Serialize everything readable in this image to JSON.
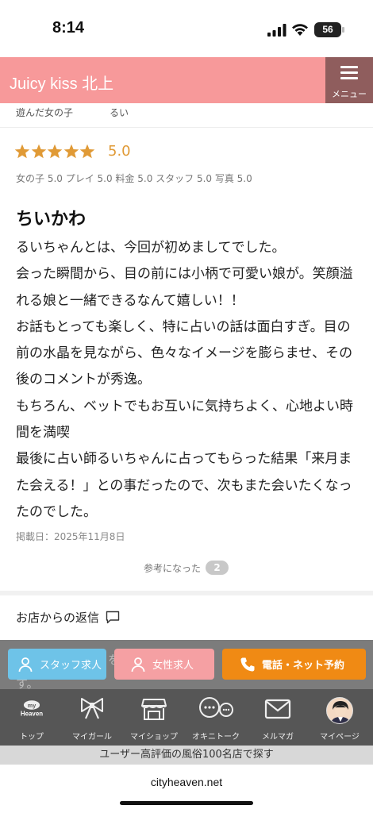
{
  "status": {
    "time": "8:14",
    "battery": "56"
  },
  "header": {
    "title": "Juicy kiss 北上",
    "menu_label": "メニュー"
  },
  "review": {
    "companion_label": "遊んだ女の子",
    "companion_name": "るい",
    "rating_value": 5.0,
    "rating_text": "5.0",
    "sub_ratings": "女の子 5.0 プレイ 5.0 料金 5.0 スタッフ 5.0 写真 5.0",
    "title": "ちいかわ",
    "body": "るいちゃんとは、今回が初めましてでした。\n会った瞬間から、目の前には小柄で可愛い娘が。笑顔溢れる娘と一緒できるなんて嬉しい！！\nお話もとっても楽しく、特に占いの話は面白すぎ。目の前の水晶を見ながら、色々なイメージを膨らませ、その後のコメントが秀逸。\nもちろん、ベットでもお互いに気持ちよく、心地よい時間を満喫\n最後に占い師るいちゃんに占ってもらった結果「来月また会える！」との事だったので、次もまた会いたくなったのでした。",
    "posted": "掲載日：2025年11月8日",
    "helpful_label": "参考になった",
    "helpful_count": "2"
  },
  "reply": {
    "header": "お店からの返信",
    "partial_line1_a": "を",
    "partial_line1_b": "ま",
    "partial_line2": "す。"
  },
  "actions": {
    "staff": "スタッフ求人",
    "female": "女性求人",
    "call": "電話・ネット予約"
  },
  "nav": [
    {
      "label": "トップ",
      "icon": "my-heaven-logo",
      "logo_text": "my",
      "logo_text2": "Heaven"
    },
    {
      "label": "マイガール",
      "icon": "ribbon-icon"
    },
    {
      "label": "マイショップ",
      "icon": "shop-icon"
    },
    {
      "label": "オキニトーク",
      "icon": "chat-bubbles-icon"
    },
    {
      "label": "メルマガ",
      "icon": "mail-icon"
    },
    {
      "label": "マイページ",
      "icon": "avatar"
    }
  ],
  "promo": "ユーザー高評価の風俗100名店で探す",
  "browser": {
    "url": "cityheaven.net"
  },
  "colors": {
    "header": "#f7999a",
    "menu": "#8f5d5d",
    "star": "#e09a36",
    "call": "#f08a14",
    "staff": "#6ec3e8",
    "female": "#f5a0a3"
  }
}
